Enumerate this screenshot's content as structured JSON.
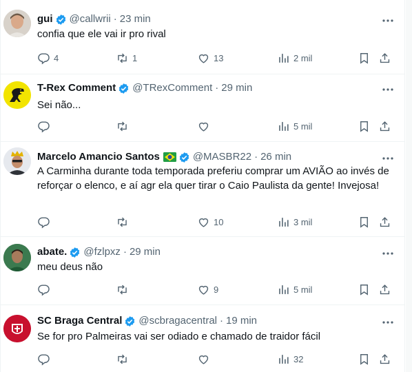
{
  "tweets": [
    {
      "name": "gui",
      "verified": true,
      "flag": false,
      "handle": "@callwrii",
      "time": "23 min",
      "text": "confia que ele vai ir pro rival",
      "replies": "4",
      "retweets": "1",
      "likes": "13",
      "views": "2 mil",
      "avatar": "photo-man"
    },
    {
      "name": "T-Rex Comment",
      "verified": true,
      "flag": false,
      "handle": "@TRexComment",
      "time": "29 min",
      "text": "Sei não...",
      "replies": "",
      "retweets": "",
      "likes": "",
      "views": "5 mil",
      "avatar": "trex-logo"
    },
    {
      "name": "Marcelo Amancio Santos",
      "verified": true,
      "flag": true,
      "handle": "@MASBR22",
      "time": "26 min",
      "text": "A Carminha durante toda temporada preferiu comprar um AVIÃO ao invés de reforçar o elenco, e aí agr ela quer tirar o Caio Paulista da gente! Invejosa!",
      "replies": "",
      "retweets": "",
      "likes": "10",
      "views": "3 mil",
      "avatar": "photo-crown"
    },
    {
      "name": "abate.",
      "verified": true,
      "flag": false,
      "handle": "@fzlpxz",
      "time": "29 min",
      "text": "meu deus não",
      "replies": "",
      "retweets": "",
      "likes": "9",
      "views": "5 mil",
      "avatar": "photo-green"
    },
    {
      "name": "SC Braga Central",
      "verified": true,
      "flag": false,
      "handle": "@scbragacentral",
      "time": "19 min",
      "text": "Se for pro Palmeiras vai ser odiado e chamado de traidor fácil",
      "replies": "",
      "retweets": "",
      "likes": "",
      "views": "32",
      "avatar": "braga-crest",
      "avatar_text": "BRAGA"
    }
  ],
  "colors": {
    "text": "#0f1419",
    "secondary": "#536471",
    "verified": "#1d9bf0",
    "border": "#eff3f4"
  }
}
